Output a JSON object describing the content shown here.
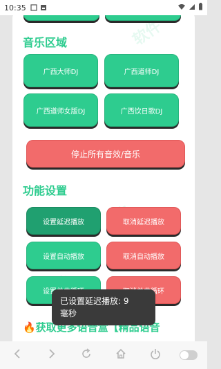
{
  "status": {
    "time": "10:35"
  },
  "music_section": {
    "title": "音乐区域",
    "buttons": [
      "广西大师DJ",
      "广西道师DJ",
      "广西道师女版DJ",
      "广西饮日歌DJ"
    ]
  },
  "stop_all_label": "停止所有音效/音乐",
  "function_section": {
    "title": "功能设置",
    "buttons": [
      {
        "label": "设置延迟播放",
        "style": "green-dark"
      },
      {
        "label": "取消延迟播放",
        "style": "red"
      },
      {
        "label": "设置自动播放",
        "style": "green"
      },
      {
        "label": "取消自动播放",
        "style": "red"
      },
      {
        "label": "设置单曲循环",
        "style": "green"
      },
      {
        "label": "取消单曲循环",
        "style": "red"
      }
    ]
  },
  "more_title": "🔥获取更多语音盒【精品语音",
  "toast": {
    "line1": "已设置延迟播放: 9",
    "line2": "毫秒"
  },
  "colors": {
    "green": "#2ecc8f",
    "red": "#f26b6b",
    "title": "#2ecc8f"
  },
  "nav_icons": [
    "back-icon",
    "forward-icon",
    "refresh-icon",
    "home-icon",
    "power-icon",
    "toggle-icon"
  ]
}
